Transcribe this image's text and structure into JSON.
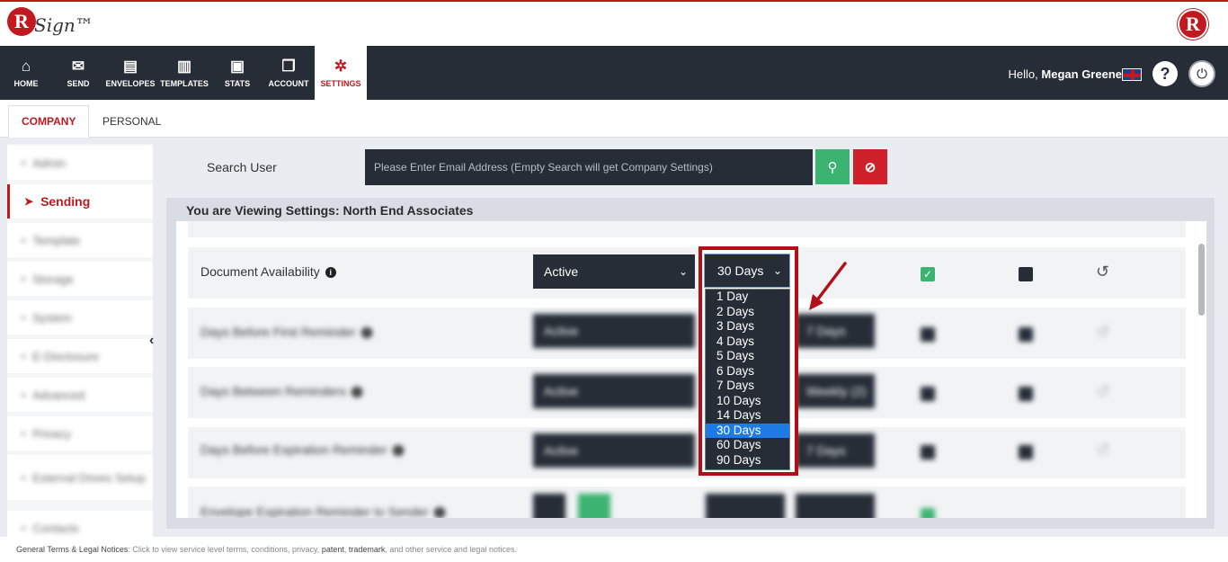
{
  "brand": {
    "logo_letter": "R",
    "logo_text": "Sign™",
    "logo_right_letter": "R"
  },
  "nav": {
    "items": [
      {
        "label": "HOME",
        "icon": "home-icon"
      },
      {
        "label": "SEND",
        "icon": "envelope-icon"
      },
      {
        "label": "ENVELOPES",
        "icon": "inbox-icon"
      },
      {
        "label": "TEMPLATES",
        "icon": "document-icon"
      },
      {
        "label": "STATS",
        "icon": "briefcase-icon"
      },
      {
        "label": "ACCOUNT",
        "icon": "copy-icon"
      },
      {
        "label": "SETTINGS",
        "icon": "gear-icon"
      }
    ],
    "hello_prefix": "Hello,",
    "user_name": "Megan Greene",
    "help_label": "?"
  },
  "tabs": [
    {
      "label": "COMPANY"
    },
    {
      "label": "PERSONAL"
    }
  ],
  "sidebar": {
    "items": [
      {
        "label": "Admin"
      },
      {
        "label": "Sending"
      },
      {
        "label": "Template"
      },
      {
        "label": "Storage"
      },
      {
        "label": "System"
      },
      {
        "label": "E-Disclosure"
      },
      {
        "label": "Advanced"
      },
      {
        "label": "Privacy"
      },
      {
        "label": "External Drives Setup"
      },
      {
        "label": "Contacts"
      }
    ]
  },
  "search": {
    "label": "Search User",
    "placeholder": "Please Enter Email Address (Empty Search will get Company Settings)"
  },
  "panel": {
    "title": "You are Viewing Settings: North End Associates",
    "rows": [
      {
        "label": "Document Availability",
        "status": "Active",
        "value": "30 Days"
      },
      {
        "label": "Days Before First Reminder",
        "status": "Active",
        "value": "7 Days"
      },
      {
        "label": "Days Between Reminders",
        "status": "Active",
        "value": "Weekly (2)"
      },
      {
        "label": "Days Before Expiration Reminder",
        "status": "Active",
        "value": "7 Days"
      },
      {
        "label": "Envelope Expiration Reminder to Sender",
        "status": "",
        "value": ""
      }
    ]
  },
  "dropdown": {
    "selected": "30 Days",
    "options": [
      "1 Day",
      "2 Days",
      "3 Days",
      "4 Days",
      "5 Days",
      "6 Days",
      "7 Days",
      "10 Days",
      "14 Days",
      "30 Days",
      "60 Days",
      "90 Days"
    ]
  },
  "footer": {
    "title": "General Terms & Legal Notices",
    "text": ": Click to view service level terms, conditions, privacy, ",
    "patent": "patent",
    "trademark": "trademark",
    "tail": ", and other service and legal notices."
  },
  "colors": {
    "brand_red": "#c0191f",
    "nav_dark": "#262d37",
    "success": "#3cb371",
    "danger": "#d0202a",
    "select_blue": "#1e7be6"
  }
}
